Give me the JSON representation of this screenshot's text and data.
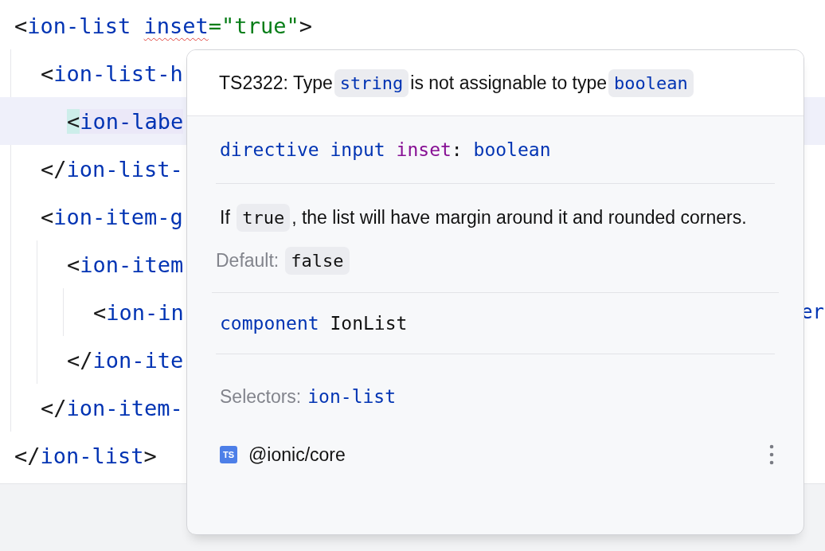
{
  "editor": {
    "lines": [
      {
        "current": false,
        "tokens": [
          {
            "kind": "punct",
            "text": "<"
          },
          {
            "kind": "tag",
            "text": "ion-list"
          },
          {
            "kind": "attr_error",
            "text": "inset"
          },
          {
            "kind": "string",
            "text": "=\"true\""
          },
          {
            "kind": "punct",
            "text": ">"
          }
        ],
        "children": [
          {
            "current": false,
            "tokens": [
              {
                "kind": "punct",
                "text": "<"
              },
              {
                "kind": "tag",
                "text": "ion-list-h"
              }
            ],
            "children": [
              {
                "current": true,
                "tokens": [
                  {
                    "kind": "punct_match",
                    "text": "<"
                  },
                  {
                    "kind": "tag_match",
                    "text": "ion-labe"
                  }
                ]
              }
            ]
          },
          {
            "current": false,
            "tokens": [
              {
                "kind": "punct",
                "text": "</"
              },
              {
                "kind": "tag",
                "text": "ion-list-"
              }
            ]
          },
          {
            "current": false,
            "tokens": [
              {
                "kind": "punct",
                "text": "<"
              },
              {
                "kind": "tag",
                "text": "ion-item-g"
              }
            ],
            "children": [
              {
                "current": false,
                "tokens": [
                  {
                    "kind": "punct",
                    "text": "<"
                  },
                  {
                    "kind": "tag",
                    "text": "ion-item"
                  }
                ],
                "children": [
                  {
                    "current": false,
                    "tokens": [
                      {
                        "kind": "punct",
                        "text": "<"
                      },
                      {
                        "kind": "tag",
                        "text": "ion-in"
                      }
                    ],
                    "trailing": "er"
                  }
                ]
              },
              {
                "current": false,
                "tokens": [
                  {
                    "kind": "punct",
                    "text": "</"
                  },
                  {
                    "kind": "tag",
                    "text": "ion-ite"
                  }
                ]
              }
            ]
          },
          {
            "current": false,
            "tokens": [
              {
                "kind": "punct",
                "text": "</"
              },
              {
                "kind": "tag",
                "text": "ion-item-"
              }
            ]
          }
        ]
      },
      {
        "current": false,
        "tokens": [
          {
            "kind": "punct",
            "text": "</"
          },
          {
            "kind": "tag",
            "text": "ion-list"
          },
          {
            "kind": "punct",
            "text": ">"
          }
        ]
      }
    ]
  },
  "popup": {
    "error": [
      {
        "kind": "text",
        "text": "TS2322: Type"
      },
      {
        "kind": "code",
        "text": "string"
      },
      {
        "kind": "text",
        "text": "is not assignable to type"
      },
      {
        "kind": "code",
        "text": "boolean"
      }
    ],
    "signature": [
      {
        "kind": "keyword",
        "text": "directive"
      },
      {
        "kind": "keyword",
        "text": "input"
      },
      {
        "kind": "name",
        "text": "inset"
      },
      {
        "kind": "punct",
        "text": ":"
      },
      {
        "kind": "keyword",
        "text": "boolean"
      }
    ],
    "description": [
      {
        "kind": "text",
        "text": "If"
      },
      {
        "kind": "plain_code",
        "text": "true"
      },
      {
        "kind": "text",
        "text": ", the list will have margin around it and rounded corners."
      }
    ],
    "default": {
      "label": "Default:",
      "value": "false"
    },
    "component": {
      "keyword": "component",
      "name": "IonList"
    },
    "selectors": {
      "label": "Selectors:",
      "value": "ion-list"
    },
    "footer": {
      "badge": "TS",
      "library": "@ionic/core"
    }
  }
}
